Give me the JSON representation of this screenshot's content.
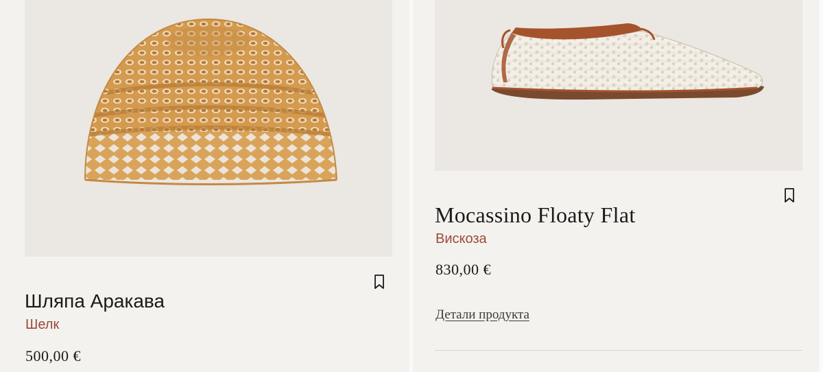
{
  "products": [
    {
      "image_alt": "Шляпа Аракава",
      "name": "Шляпа Аракава",
      "material": "Шелк",
      "price": "500,00 €",
      "bookmark_icon": "bookmark-icon"
    },
    {
      "image_alt": "Mocassino Floaty Flat",
      "name": "Mocassino Floaty Flat",
      "material": "Вискоза",
      "price": "830,00 €",
      "details_label": "Детали продукта",
      "bookmark_icon": "bookmark-icon"
    }
  ],
  "colors": {
    "background": "#f4f2ee",
    "image_background": "#ebe7e2",
    "material_accent": "#9a4a3a",
    "text": "#1a1a1a",
    "hat_yarn": "#d9a45a",
    "shoe_lace": "#f3efe6",
    "shoe_trim": "#a5532c"
  }
}
